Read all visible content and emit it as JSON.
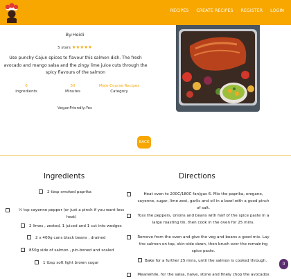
{
  "nav": {
    "links": [
      "RECIPES",
      "CREATE RECIPES",
      "REGISTER",
      "LOGIN"
    ]
  },
  "recipe": {
    "author": "By:Heidi",
    "rating_text": "5 stars",
    "rating": 5,
    "description": "Use punchy Cajun spices to flavour this salmon dish. The fresh avocado and mango salsa and the zingy lime juice cuts through the spicy flavours of the salmon",
    "ingredients_count": "6",
    "ingredients_label": "Ingredients",
    "minutes": "50",
    "minutes_label": "Minutes",
    "category": "Main-Course Recipes",
    "category_label": "Category",
    "tags": "VeganFriendly:Yes"
  },
  "back_label": "BACK",
  "ingredients": {
    "title": "Ingredients",
    "items": [
      "2 tbsp smoked paprika",
      "½ tsp cayenne pepper (or just a pinch if you want less heat)",
      "2 limes , zested, 1 juiced and 1 cut into wedges",
      "2 x 400g cans black beans , drained",
      "850g side of salmon , pin-boned and scaled",
      "1 tbsp soft light brown sugar"
    ]
  },
  "directions": {
    "title": "Directions",
    "items": [
      "Heat oven to 200C/180C fan/gas 6. Mix the paprika, oregano, cayenne, sugar, lime zest, garlic and oil in a bowl with a good pinch of salt.",
      "Toss the peppers, onions and beans with half of the spice paste in a large roasting tin, then cook in the oven for 25 mins.",
      "Remove from the oven and give the veg and beans a good mix. Lay the salmon on top, skin-side down, then brush over the remaining spice paste.",
      "Bake for a further 25 mins, until the salmon is cooked through.",
      "Meanwhile, for the salsa, halve, stone and finely chop the avocados"
    ]
  },
  "fab_icon": "chat-icon",
  "colors": {
    "accent": "#f7a700",
    "fab": "#5b2c6f"
  }
}
